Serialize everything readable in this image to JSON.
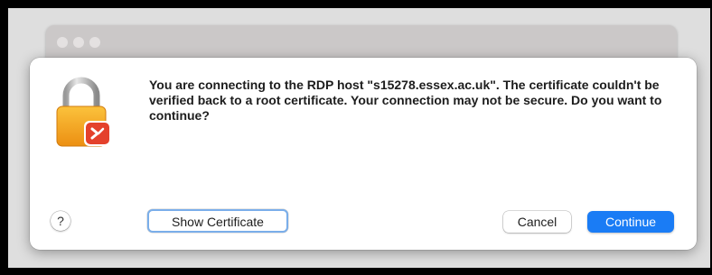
{
  "dialog": {
    "message": "You are connecting to the RDP host \"s15278.essex.ac.uk\". The certificate couldn't be verified back to a root certificate. Your connection may not be secure. Do you want to continue?",
    "icon": "lock-with-remote-desktop-badge-icon",
    "help_label": "?",
    "buttons": {
      "show_certificate": "Show Certificate",
      "cancel": "Cancel",
      "continue": "Continue"
    }
  },
  "colors": {
    "accent": "#1a7cf5",
    "lock_body": "#f4a31c",
    "badge": "#e4412c"
  }
}
